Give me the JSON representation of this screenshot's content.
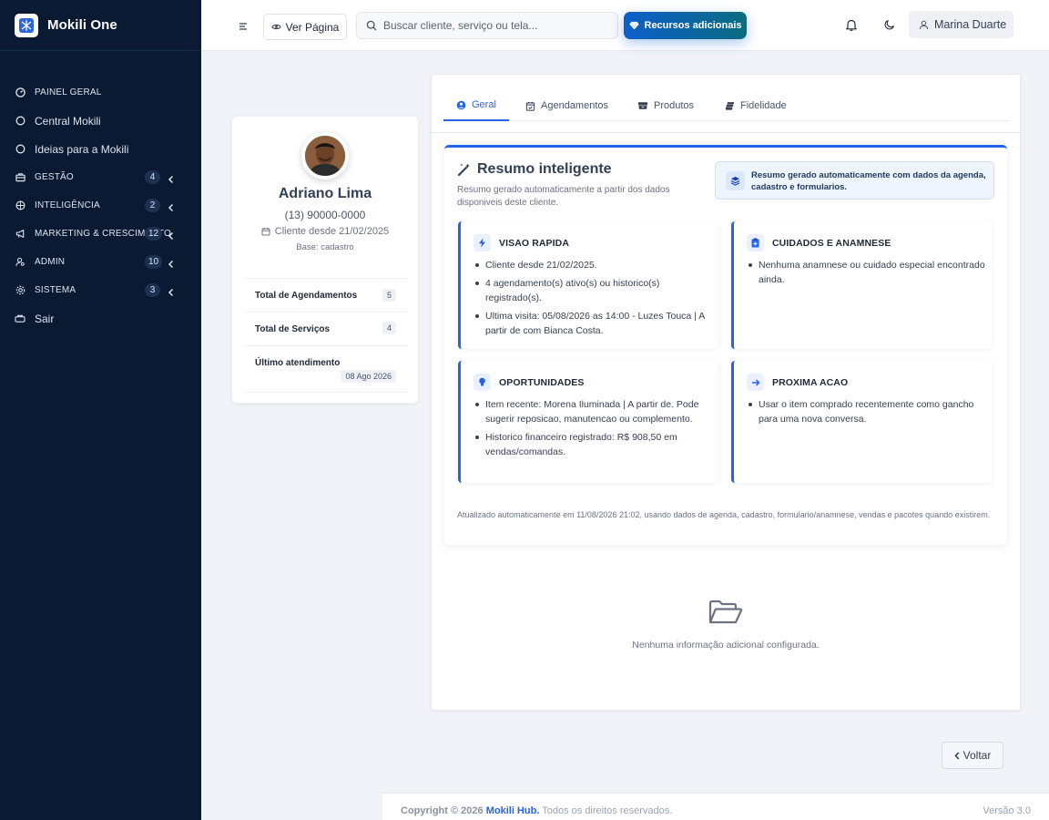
{
  "brand": {
    "name": "Mokili One"
  },
  "sidebar": {
    "items": [
      {
        "label": "PAINEL GERAL",
        "icon": "dashboard-icon",
        "caps": true
      },
      {
        "label": "Central Mokili",
        "icon": "circle-icon"
      },
      {
        "label": "Ideias para a Mokili",
        "icon": "circle-icon"
      },
      {
        "label": "GESTÃO",
        "icon": "briefcase-icon",
        "badge": "4",
        "caps": true
      },
      {
        "label": "INTELIGÊNCIA",
        "icon": "brain-icon",
        "badge": "2",
        "caps": true
      },
      {
        "label": "MARKETING & CRESCIMENTO",
        "icon": "megaphone-icon",
        "badge": "12",
        "caps": true
      },
      {
        "label": "ADMIN",
        "icon": "user-cog-icon",
        "badge": "10",
        "caps": true
      },
      {
        "label": "SISTEMA",
        "icon": "settings-icon",
        "badge": "3",
        "caps": true
      },
      {
        "label": "Sair",
        "icon": "logout-icon"
      }
    ]
  },
  "topbar": {
    "ver_pagina": "Ver Página",
    "search_placeholder": "Buscar cliente, serviço ou tela...",
    "recursos": "Recursos adicionais",
    "user_name": "Marina Duarte"
  },
  "profile": {
    "name": "Adriano Lima",
    "phone": "(13) 90000-0000",
    "since": "Cliente desde 21/02/2025",
    "base": "Base: cadastro",
    "stats": {
      "agendamentos_label": "Total de Agendamentos",
      "agendamentos_value": "5",
      "servicos_label": "Total de Serviços",
      "servicos_value": "4",
      "ultimo_label": "Último atendimento",
      "ultimo_value": "08 Ago 2026"
    }
  },
  "tabs": [
    {
      "label": "Geral",
      "icon": "user-circle-icon",
      "active": true
    },
    {
      "label": "Agendamentos",
      "icon": "calendar-check-icon"
    },
    {
      "label": "Produtos",
      "icon": "boxes-icon"
    },
    {
      "label": "Fidelidade",
      "icon": "stack-icon"
    }
  ],
  "summary": {
    "title": "Resumo inteligente",
    "subtitle": "Resumo gerado automaticamente a partir dos dados disponiveis deste cliente.",
    "note": "Resumo gerado automaticamente com dados da agenda, cadastro e formularios.",
    "boxes": {
      "visao": {
        "title": "VISAO RAPIDA",
        "items": [
          "Cliente desde 21/02/2025.",
          "4 agendamento(s) ativo(s) ou historico(s) registrado(s).",
          "Ultima visita: 05/08/2026 as 14:00 - Luzes Touca | A partir de com Bianca Costa."
        ]
      },
      "cuidados": {
        "title": "CUIDADOS E ANAMNESE",
        "items": [
          "Nenhuma anamnese ou cuidado especial encontrado ainda."
        ]
      },
      "oportunidades": {
        "title": "OPORTUNIDADES",
        "items": [
          "Item recente: Morena Iluminada | A partir de. Pode sugerir reposicao, manutencao ou complemento.",
          "Historico financeiro registrado: R$ 908,50 em vendas/comandas."
        ]
      },
      "proxima": {
        "title": "PROXIMA ACAO",
        "items": [
          "Usar o item comprado recentemente como gancho para uma nova conversa."
        ]
      }
    },
    "footer": "Atualizado automaticamente em 11/08/2026 21:02, usando dados de agenda, cadastro, formulario/anamnese, vendas e pacotes quando existirem."
  },
  "empty": {
    "text": "Nenhuma informação adicional configurada."
  },
  "actions": {
    "voltar": "Voltar"
  },
  "footer": {
    "copyright": "Copyright © 2026",
    "hub": "Mokili Hub.",
    "rights": "Todos os direitos reservados.",
    "version": "Versão 3.0"
  },
  "colors": {
    "sidebar_bg": "#0b1a33",
    "accent": "#2563eb",
    "page_bg": "#f2f3f8"
  }
}
